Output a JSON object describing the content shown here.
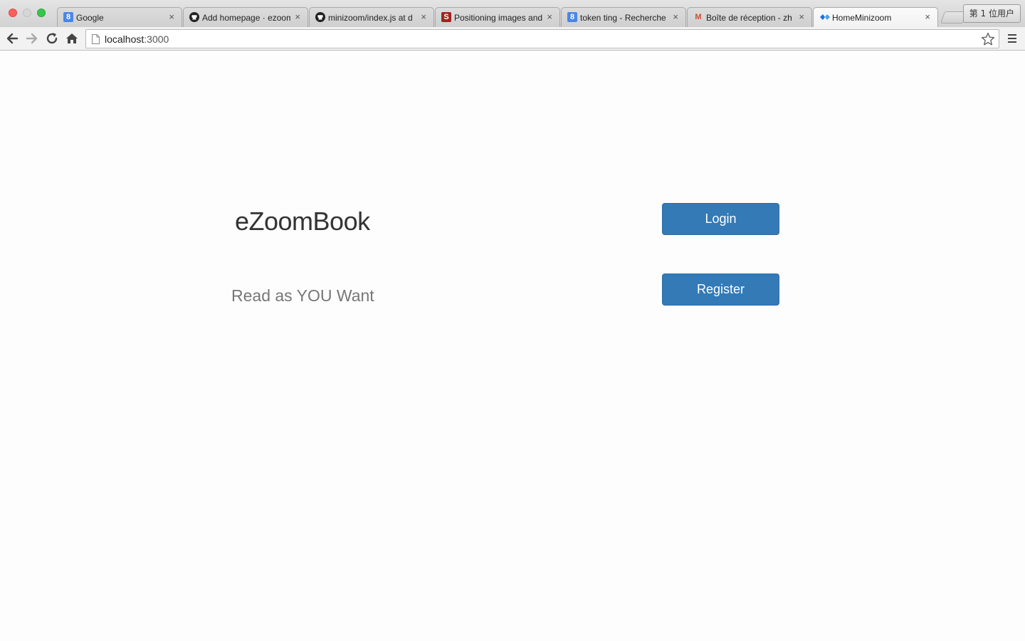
{
  "browser": {
    "tabs": [
      {
        "title": "Google",
        "icon": "google-icon",
        "favicon_char": "8",
        "color": "#4a86e8"
      },
      {
        "title": "Add homepage · ezoom",
        "icon": "github-icon",
        "favicon_char": "",
        "color": "#222222"
      },
      {
        "title": "minizoom/index.js at d",
        "icon": "github-icon",
        "favicon_char": "",
        "color": "#222222"
      },
      {
        "title": "Positioning images and",
        "icon": "stackoverflow-s-icon",
        "favicon_char": "S",
        "color": "#a3201f"
      },
      {
        "title": "token ting - Recherche",
        "icon": "google-icon",
        "favicon_char": "8",
        "color": "#4a86e8"
      },
      {
        "title": "Boîte de réception - zh",
        "icon": "gmail-icon",
        "favicon_char": "M",
        "color": "#d14836"
      },
      {
        "title": "HomeMinizoom",
        "icon": "diamond-icon",
        "favicon_char": "",
        "color": "#1e6fd8"
      }
    ],
    "tab_close": "×",
    "profile_label": "第 1 位用户",
    "url_host": "localhost",
    "url_rest": ":3000"
  },
  "page": {
    "brand": "eZoomBook",
    "tagline": "Read as YOU Want",
    "login_label": "Login",
    "register_label": "Register"
  },
  "colors": {
    "primary_button": "#337ab7",
    "brand_text": "#333333",
    "tagline_text": "#777777"
  }
}
